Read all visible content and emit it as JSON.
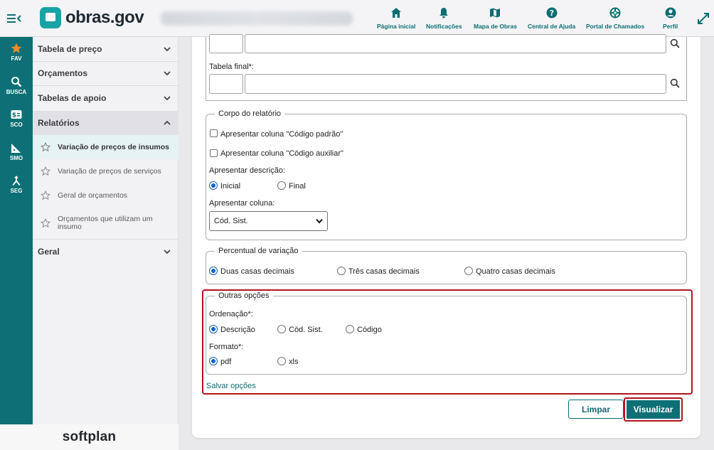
{
  "header": {
    "logo_text": "obras.gov",
    "nav": [
      {
        "label": "Página inicial",
        "icon": "home-icon"
      },
      {
        "label": "Notificações",
        "icon": "bell-icon"
      },
      {
        "label": "Mapa de Obras",
        "icon": "map-icon"
      },
      {
        "label": "Central de Ajuda",
        "icon": "help-icon"
      },
      {
        "label": "Portal de Chamados",
        "icon": "lifebuoy-icon"
      },
      {
        "label": "Perfil",
        "icon": "user-icon"
      }
    ],
    "accent": "#0b6e73"
  },
  "rail": {
    "items": [
      {
        "label": "FAV",
        "icon": "star-icon"
      },
      {
        "label": "BUSCA",
        "icon": "search-icon"
      },
      {
        "label": "SCO",
        "icon": "dollar-card-icon"
      },
      {
        "label": "SMO",
        "icon": "ruler-triangle-icon"
      },
      {
        "label": "SEG",
        "icon": "merge-icon"
      }
    ],
    "color": "#0d7076"
  },
  "sidebar": {
    "sections": [
      {
        "label": "Tabela de preço"
      },
      {
        "label": "Orçamentos"
      },
      {
        "label": "Tabelas de apoio"
      },
      {
        "label": "Relatórios"
      },
      {
        "label": "Geral"
      }
    ],
    "report_items": [
      {
        "label": "Variação de preços de insumos"
      },
      {
        "label": "Variação de preços de serviços"
      },
      {
        "label": "Geral de orçamentos"
      },
      {
        "label": "Orçamentos que utilizam um insumo"
      }
    ],
    "brand": "softplan"
  },
  "form": {
    "tabela_final_label": "Tabela final*:",
    "corpo": {
      "legend": "Corpo do relatório",
      "cb_codigo_padrao": "Apresentar coluna \"Código padrão\"",
      "cb_codigo_auxiliar": "Apresentar coluna \"Código auxiliar\"",
      "descricao_label": "Apresentar descrição:",
      "desc_inicial": "Inicial",
      "desc_final": "Final",
      "coluna_label": "Apresentar coluna:",
      "coluna_value": "Cód. Sist."
    },
    "percentual": {
      "legend": "Percentual de variação",
      "opt_duas": "Duas casas decimais",
      "opt_tres": "Três casas decimais",
      "opt_quatro": "Quatro casas decimais"
    },
    "outras": {
      "legend": "Outras opções",
      "ordenacao_label": "Ordenação*:",
      "ord_descricao": "Descrição",
      "ord_cod_sist": "Cód. Sist.",
      "ord_codigo": "Código",
      "formato_label": "Formato*:",
      "fmt_pdf": "pdf",
      "fmt_xls": "xls"
    },
    "salvar_opcoes": "Salvar opções",
    "btn_limpar": "Limpar",
    "btn_visualizar": "Visualizar"
  }
}
